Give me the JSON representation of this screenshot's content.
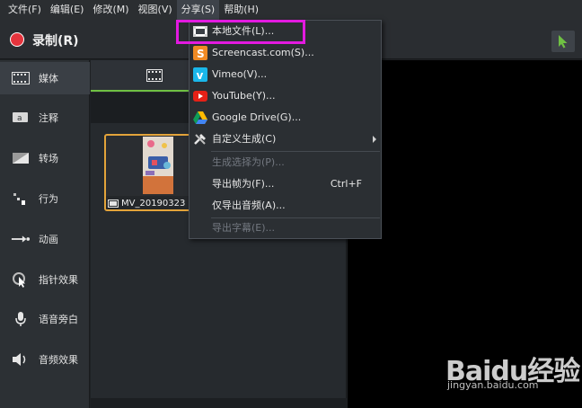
{
  "menubar": {
    "items": [
      "文件(F)",
      "编辑(E)",
      "修改(M)",
      "视图(V)",
      "分享(S)",
      "帮助(H)"
    ]
  },
  "toolbar": {
    "record_label": "录制(R)"
  },
  "sidebar": {
    "items": [
      {
        "label": "媒体",
        "icon": "film-strip-icon"
      },
      {
        "label": "注释",
        "icon": "annotation-icon"
      },
      {
        "label": "转场",
        "icon": "transition-icon"
      },
      {
        "label": "行为",
        "icon": "behavior-icon"
      },
      {
        "label": "动画",
        "icon": "animation-icon"
      },
      {
        "label": "指针效果",
        "icon": "cursor-effect-icon"
      },
      {
        "label": "语音旁白",
        "icon": "microphone-icon"
      },
      {
        "label": "音频效果",
        "icon": "speaker-icon"
      }
    ]
  },
  "media": {
    "thumb_caption": "MV_20190323"
  },
  "share_menu": {
    "items": [
      {
        "label": "本地文件(L)...",
        "icon": "local-file-icon",
        "enabled": true
      },
      {
        "label": "Screencast.com(S)...",
        "icon": "screencast-icon",
        "enabled": true
      },
      {
        "label": "Vimeo(V)...",
        "icon": "vimeo-icon",
        "enabled": true
      },
      {
        "label": "YouTube(Y)...",
        "icon": "youtube-icon",
        "enabled": true
      },
      {
        "label": "Google Drive(G)...",
        "icon": "google-drive-icon",
        "enabled": true
      },
      {
        "label": "自定义生成(C)",
        "icon": "tools-icon",
        "enabled": true,
        "submenu": true
      },
      {
        "label": "生成选择为(P)...",
        "enabled": false
      },
      {
        "label": "导出帧为(F)...",
        "enabled": true,
        "shortcut": "Ctrl+F"
      },
      {
        "label": "仅导出音频(A)...",
        "enabled": true
      },
      {
        "label": "导出字幕(E)...",
        "enabled": false
      }
    ]
  },
  "watermark": {
    "brand": "Baidu经验",
    "url": "jingyan.baidu.com"
  },
  "colors": {
    "accent_green": "#6fc043",
    "highlight": "#e21ae0",
    "record_red": "#e5343d",
    "thumb_border": "#e3a33a"
  }
}
